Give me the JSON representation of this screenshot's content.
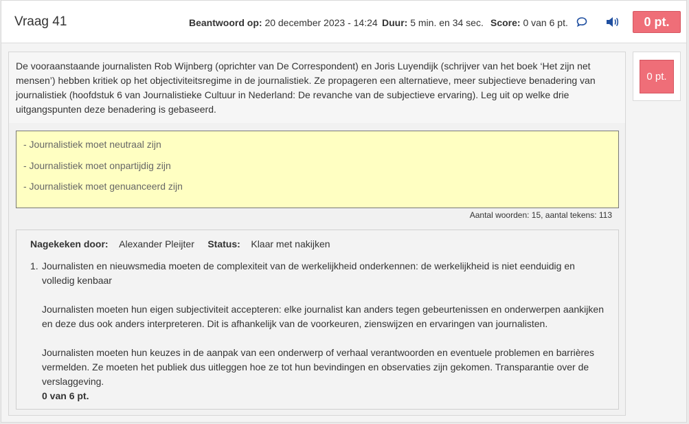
{
  "header": {
    "title": "Vraag 41",
    "answered_label": "Beantwoord op:",
    "answered_value": "20 december 2023 - 14:24",
    "duration_label": "Duur:",
    "duration_value": "5 min. en 34 sec.",
    "score_label": "Score:",
    "score_value": "0 van 6 pt.",
    "badge": "0 pt.",
    "icons": [
      "comment-icon",
      "speaker-icon"
    ]
  },
  "question": {
    "text": "De vooraanstaande journalisten Rob Wijnberg (oprichter van De Correspondent) en Joris Luyendijk (schrijver van het boek ‘Het zijn net mensen’) hebben kritiek op het objectiviteitsregime in de journalistiek. Ze propageren een alternatieve, meer subjectieve benadering van journalistiek (hoofdstuk 6 van Journalistieke Cultuur in Nederland: De revanche van de subjectieve ervaring). Leg uit op welke drie uitgangspunten deze benadering is gebaseerd."
  },
  "answer": {
    "lines": [
      "-  Journalistiek moet neutraal zijn",
      "- Journalistiek moet onpartijdig zijn",
      "- Journalistiek moet genuanceerd zijn"
    ],
    "wordcount": "Aantal woorden: 15, aantal tekens: 113"
  },
  "review": {
    "reviewed_by_label": "Nagekeken door:",
    "reviewer": "Alexander Pleijter",
    "status_label": "Status:",
    "status": "Klaar met nakijken",
    "number": "1.",
    "paragraphs": [
      "Journalisten en nieuwsmedia moeten de complexiteit van de werkelijkheid onderkennen: de werkelijkheid is niet eenduidig en volledig kenbaar",
      "Journalisten moeten hun eigen subjectiviteit accepteren: elke journalist kan anders tegen gebeurtenissen en onderwerpen aankijken en deze dus ook anders interpreteren. Dit is afhankelijk van de voorkeuren, zienswijzen en ervaringen van journalisten.",
      "Journalisten moeten hun keuzes in de aanpak van een onderwerp of verhaal verantwoorden en eventuele problemen en barrières vermelden. Ze moeten het publiek dus uitleggen hoe ze tot hun bevindingen en observaties zijn gekomen. Transparantie over de verslaggeving."
    ],
    "score": "0 van 6 pt."
  },
  "side": {
    "badge": "0 pt."
  },
  "colors": {
    "badge_red": "#ef6e78",
    "answer_bg": "#ffffc2",
    "icon_blue": "#1f4fa0"
  }
}
